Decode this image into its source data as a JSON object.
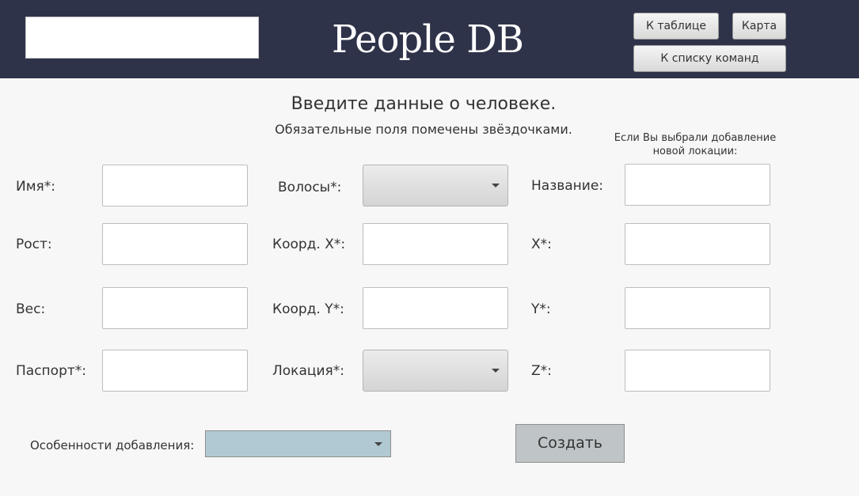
{
  "header": {
    "search_value": "",
    "app_title": "People DB",
    "btn_table": "К таблице",
    "btn_map": "Карта",
    "btn_teams": "К списку команд"
  },
  "form": {
    "title": "Введите данные о человеке.",
    "subtitle": "Обязательные поля помечены звёздочками.",
    "location_note": "Если Вы выбрали добавление новой локации:",
    "col1": {
      "name_label": "Имя*:",
      "height_label": "Рост:",
      "weight_label": "Вес:",
      "passport_label": "Паспорт*:"
    },
    "col2": {
      "hair_label": "Волосы*:",
      "coord_x_label": "Коорд. X*:",
      "coord_y_label": "Коорд. Y*:",
      "location_label": "Локация*:",
      "hair_value": "",
      "location_value": ""
    },
    "col3": {
      "loc_name_label": "Название:",
      "x_label": "X*:",
      "y_label": "Y*:",
      "z_label": "Z*:"
    },
    "add_mode_label": "Особенности добавления:",
    "add_mode_value": "",
    "create_button": "Создать"
  },
  "colors": {
    "header_bg": "#2f3349",
    "page_bg": "#f7f7f7",
    "mode_select_bg": "#b1c9d2",
    "create_button_bg": "#bfc4c7"
  }
}
